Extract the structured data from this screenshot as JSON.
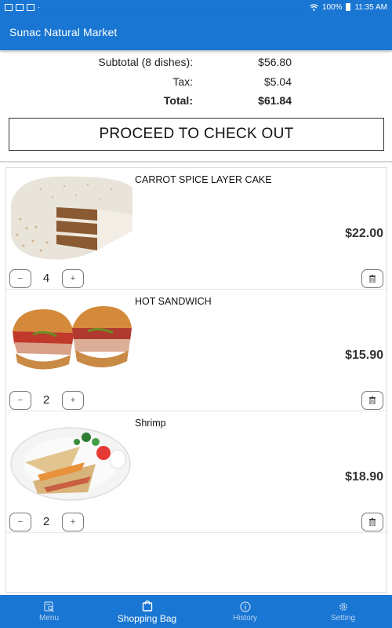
{
  "status_bar": {
    "battery": "100%",
    "time": "11:35 AM"
  },
  "app_bar": {
    "title": "Sunac Natural Market"
  },
  "totals": {
    "subtotal_label": "Subtotal (8 dishes):",
    "subtotal_value": "$56.80",
    "tax_label": "Tax:",
    "tax_value": "$5.04",
    "total_label": "Total:",
    "total_value": "$61.84"
  },
  "checkout_button_label": "PROCEED TO CHECK OUT",
  "cart": {
    "items": [
      {
        "name": "CARROT SPICE LAYER CAKE",
        "price": "$22.00",
        "quantity": "4",
        "image_icon": "carrot-cake-image"
      },
      {
        "name": "HOT SANDWICH",
        "price": "$15.90",
        "quantity": "2",
        "image_icon": "sandwich-image"
      },
      {
        "name": "Shrimp",
        "price": "$18.90",
        "quantity": "2",
        "image_icon": "quesadilla-plate-image"
      }
    ],
    "minus_label": "−",
    "plus_label": "+"
  },
  "bottom_nav": {
    "items": [
      {
        "label": "Menu",
        "icon": "menu-search-icon",
        "active": false
      },
      {
        "label": "Shopping Bag",
        "icon": "shopping-bag-icon",
        "active": true
      },
      {
        "label": "History",
        "icon": "info-icon",
        "active": false
      },
      {
        "label": "Setting",
        "icon": "gear-icon",
        "active": false
      }
    ]
  },
  "colors": {
    "primary": "#1976d2",
    "nav_inactive": "#b9d4f2"
  }
}
